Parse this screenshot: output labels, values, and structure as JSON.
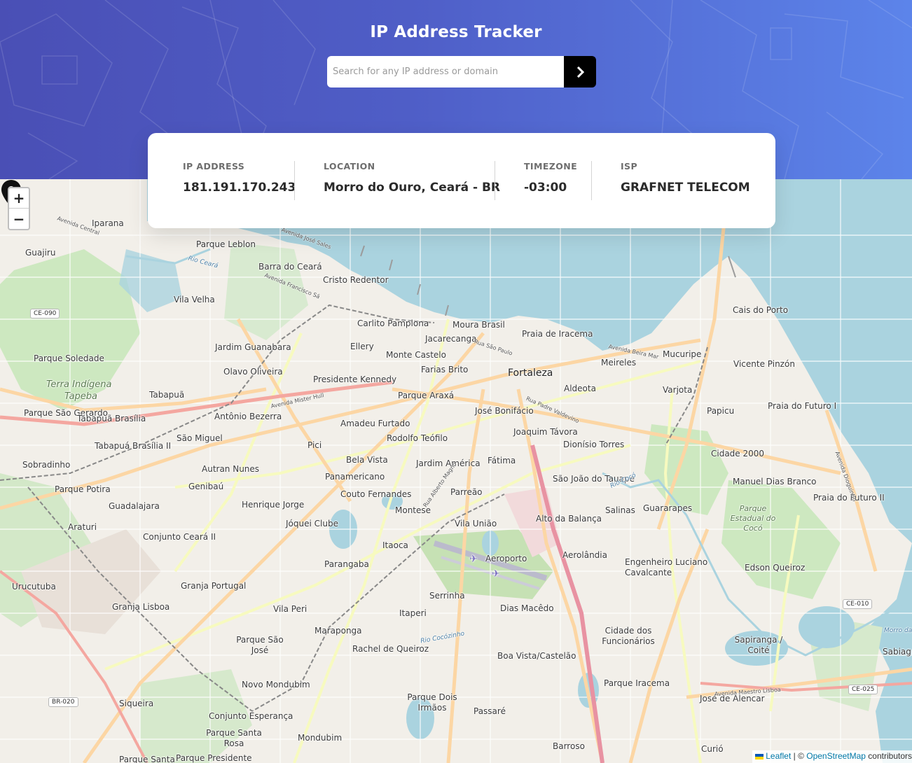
{
  "header": {
    "title": "IP Address Tracker",
    "search_placeholder": "Search for any IP address or domain",
    "search_value": ""
  },
  "info": {
    "ip_label": "IP ADDRESS",
    "ip_value": "181.191.170.243",
    "location_label": "LOCATION",
    "location_value": "Morro do Ouro, Ceará - BR",
    "timezone_label": "TIMEZONE",
    "timezone_value": "-03:00",
    "isp_label": "ISP",
    "isp_value": "GRAFNET TELECOM"
  },
  "map": {
    "zoom_in": "+",
    "zoom_out": "−",
    "places": {
      "ipanema": "Iparana",
      "guajiru": "Guajiru",
      "parque_leblon": "Parque Leblon",
      "barra_do_ceara": "Barra do Ceará",
      "cristo_redentor": "Cristo Redentor",
      "vila_velha": "Vila Velha",
      "carlito_pamplona": "Carlito Pamplona",
      "moura_brasil": "Moura Brasil",
      "jacarecanga": "Jacarecanga",
      "praia_de_iracema": "Praia de Iracema",
      "cais_do_porto": "Cais do Porto",
      "jardim_guanabara": "Jardim Guanabara",
      "ellery": "Ellery",
      "monte_castelo": "Monte Castelo",
      "farias_brito": "Farias Brito",
      "meireles": "Meireles",
      "mucuripe": "Mucuripe",
      "vicente_pinzon": "Vicente Pinzón",
      "parque_soledade": "Parque Soledade",
      "olavo_oliveira": "Olavo Oliveira",
      "presidente_kennedy": "Presidente Kennedy",
      "fortaleza": "Fortaleza",
      "aldeota": "Aldeota",
      "varjota": "Varjota",
      "terra_indigena": "Terra Indígena",
      "tapeba": "Tapeba",
      "tabapua": "Tabapuã",
      "parque_arax": "Parque Araxá",
      "jose_bonifacio": "José Bonifácio",
      "papicu": "Papicu",
      "praia_do_futuro_1": "Praia do Futuro I",
      "parque_sao_gerardo": "Parque São Gerardo",
      "tabapua_brasilia": "Tabapuã Brasília",
      "antonio_bezerra": "Antônio Bezerra",
      "amadeu_furtado": "Amadeu Furtado",
      "joaquim_tavora": "Joaquim Távora",
      "sao_miguel": "São Miguel",
      "pici": "Pici",
      "rodolfo_teofilo": "Rodolfo Teófilo",
      "dionisio_torres": "Dionísio Torres",
      "tabapua_brasilia_2": "Tabapuá Brasília II",
      "cidade_2000": "Cidade 2000",
      "sobradinho": "Sobradinho",
      "bela_vista": "Bela Vista",
      "jardim_america": "Jardim América",
      "fatima": "Fátima",
      "autran_nunes": "Autran Nunes",
      "panamericano": "Panamericano",
      "sao_joao_do_tauape": "São João do Tauape",
      "manuel_dias_branco": "Manuel Dias Branco",
      "parque_potira": "Parque Potira",
      "genibau": "Genibaú",
      "couto_fernandes": "Couto Fernandes",
      "parreao": "Parreão",
      "praia_do_futuro_2": "Praia do Futuro II",
      "guadalajara": "Guadalajara",
      "henrique_jorge": "Henrique Jorge",
      "montese": "Montese",
      "salinas": "Salinas",
      "guararapes": "Guararapes",
      "parque_estadual_coco": "Parque Estadual do Cocó",
      "araturi": "Araturi",
      "joquei_clube": "Jóquei Clube",
      "vila_uniao": "Vila União",
      "alto_da_balanca": "Alto da Balança",
      "conjunto_ceara_2": "Conjunto Ceará II",
      "itaoca": "Itaoca",
      "parangaba": "Parangaba",
      "aeroporto": "Aeroporto",
      "aerolandia": "Aerolândia",
      "engenheiro_luciano": "Engenheiro Luciano Cavalcante",
      "edson_queiroz": "Edson Queiroz",
      "urucutuba": "Urucutuba",
      "granja_portugal": "Granja Portugal",
      "serrinha": "Serrinha",
      "granja_lisboa": "Granja Lisboa",
      "vila_peri": "Vila Peri",
      "itaperi": "Itaperi",
      "dias_macedo": "Dias Macêdo",
      "maraponga": "Maraponga",
      "parque_sao_jose": "Parque São José",
      "rachel_de_queiroz": "Rachel de Queiroz",
      "cidade_dos_funcionarios": "Cidade dos Funcionários",
      "sapiranga_coite": "Sapiranga / Coité",
      "boa_vista_castelao": "Boa Vista/Castelão",
      "novo_mondubim": "Novo Mondubim",
      "parque_iracema": "Parque Iracema",
      "siqueira": "Siqueira",
      "parque_dois_irmaos": "Parque Dois Irmãos",
      "jose_de_alencar": "José de Alencar",
      "conjunto_esperanca": "Conjunto Esperança",
      "passare": "Passaré",
      "parque_santa_rosa": "Parque Santa Rosa",
      "mondubim": "Mondubim",
      "barroso": "Barroso",
      "curio": "Curió",
      "parque_santa": "Parque Santa",
      "parque_presidente": "Parque Presidente",
      "sabiagu": "Sabiagu",
      "morro_da_boleia": "Morro da Boleia"
    },
    "roads": {
      "av_jose_sales": "Avenida José Sales",
      "av_francisco_sa": "Avenida Francisco Sá",
      "av_mister_hull": "Avenida Mister Hull",
      "rua_sao_paulo": "Rua São Paulo",
      "av_beira_mar": "Avenida Beira Mar",
      "rua_pedro_valdevino": "Rua Padre Valdevino",
      "rua_alberto_magno": "Rua Alberto Magno",
      "av_dioguinho": "Avenida Dioguinho",
      "av_central": "Avenida Central",
      "av_maestro_lisboa": "Avenida Maestro Lisboa",
      "rio_ceara": "Rio Ceará",
      "rio_coco": "Rio Cocó",
      "rio_cocozinho": "Rio Cocózinho"
    },
    "shields": {
      "ce090": "CE-090",
      "ce010": "CE-010",
      "br020": "BR-020",
      "ce025": "CE-025"
    },
    "attribution": {
      "leaflet": "Leaflet",
      "sep": " | © ",
      "osm": "OpenStreetMap",
      "rest": " contributors"
    }
  }
}
